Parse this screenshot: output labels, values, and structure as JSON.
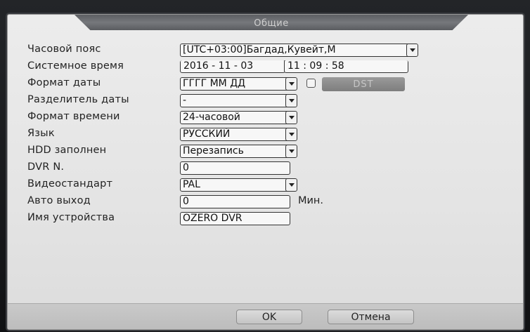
{
  "dialog": {
    "title": "Общие"
  },
  "fields": {
    "timezone": {
      "label": "Часовой пояс",
      "value": "[UTC+03:00]Багдад,Кувейт,М"
    },
    "system_time": {
      "label": "Системное время",
      "date": "2016 - 11 - 03",
      "time": "11 : 09 : 58"
    },
    "date_format": {
      "label": "Формат даты",
      "value": "ГГГГ ММ ДД"
    },
    "dst": {
      "label": "DST"
    },
    "date_separator": {
      "label": "Разделитель даты",
      "value": "-"
    },
    "time_format": {
      "label": "Формат времени",
      "value": "24-часовой"
    },
    "language": {
      "label": "Язык",
      "value": "РУССКИЙ"
    },
    "hdd_full": {
      "label": "HDD заполнен",
      "value": "Перезапись"
    },
    "dvr_no": {
      "label": "DVR N.",
      "value": "0"
    },
    "video_standard": {
      "label": "Видеостандарт",
      "value": "PAL"
    },
    "auto_logout": {
      "label": "Авто выход",
      "value": "0",
      "unit": "Мин."
    },
    "device_name": {
      "label": "Имя устройства",
      "value": "OZERO DVR"
    }
  },
  "buttons": {
    "ok": "OK",
    "cancel": "Отмена"
  }
}
